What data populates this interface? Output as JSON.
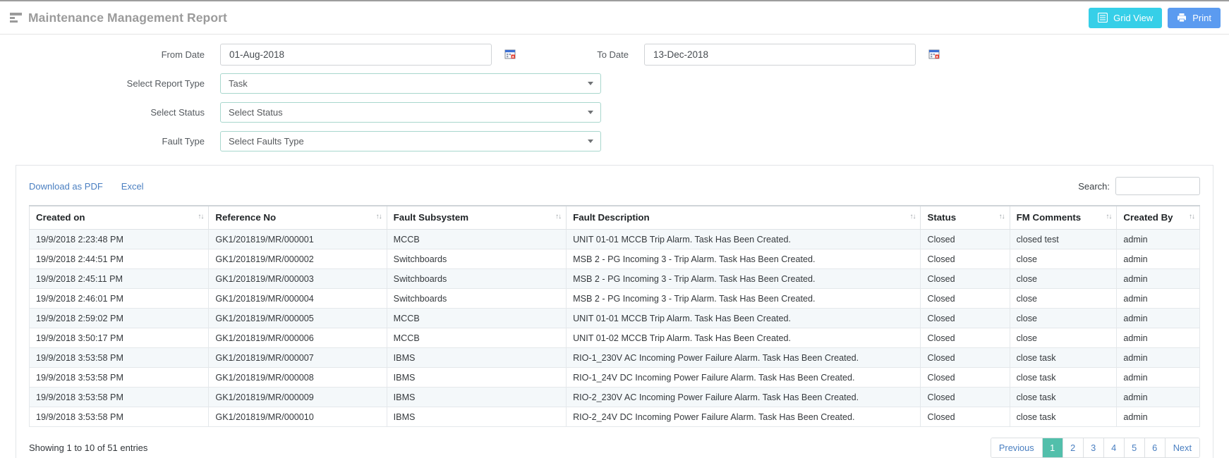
{
  "header": {
    "title": "Maintenance Management Report",
    "icon": "report-lines-icon",
    "buttons": [
      {
        "label": "Grid  View",
        "icon": "grid-icon",
        "color": "#36cfe8",
        "name": "grid-view-button"
      },
      {
        "label": "Print",
        "icon": "printer-icon",
        "color": "#5b9bf0",
        "name": "print-button"
      }
    ]
  },
  "filters": {
    "from_date": {
      "label": "From Date",
      "value": "01-Aug-2018",
      "placeholder": "From Date",
      "calendar_icon": "calendar-icon"
    },
    "to_date": {
      "label": "To Date",
      "value": "13-Dec-2018",
      "placeholder": "To Date",
      "calendar_icon": "calendar-icon"
    },
    "report_type": {
      "label": "Select Report Type",
      "value": "Task"
    },
    "status": {
      "label": "Select Status",
      "value": "Select Status"
    },
    "fault_type": {
      "label": "Fault Type",
      "value": "Select Faults Type"
    }
  },
  "table_tools": {
    "download_pdf": "Download as PDF",
    "excel": "Excel",
    "search_label": "Search:",
    "search_value": "",
    "search_placeholder": ""
  },
  "table": {
    "sort_icon": "↑↓",
    "columns": [
      "Created on",
      "Reference No",
      "Fault Subsystem",
      "Fault Description",
      "Status",
      "FM Comments",
      "Created By"
    ],
    "rows": [
      [
        "19/9/2018 2:23:48 PM",
        "GK1/201819/MR/000001",
        "MCCB",
        "UNIT 01-01 MCCB Trip Alarm. Task Has Been Created.",
        "Closed",
        "closed test",
        "admin"
      ],
      [
        "19/9/2018 2:44:51 PM",
        "GK1/201819/MR/000002",
        "Switchboards",
        "MSB 2 - PG Incoming 3 - Trip Alarm. Task Has Been Created.",
        "Closed",
        "close",
        "admin"
      ],
      [
        "19/9/2018 2:45:11 PM",
        "GK1/201819/MR/000003",
        "Switchboards",
        "MSB 2 - PG Incoming 3 - Trip Alarm. Task Has Been Created.",
        "Closed",
        "close",
        "admin"
      ],
      [
        "19/9/2018 2:46:01 PM",
        "GK1/201819/MR/000004",
        "Switchboards",
        "MSB 2 - PG Incoming 3 - Trip Alarm. Task Has Been Created.",
        "Closed",
        "close",
        "admin"
      ],
      [
        "19/9/2018 2:59:02 PM",
        "GK1/201819/MR/000005",
        "MCCB",
        "UNIT 01-01 MCCB Trip Alarm. Task Has Been Created.",
        "Closed",
        "close",
        "admin"
      ],
      [
        "19/9/2018 3:50:17 PM",
        "GK1/201819/MR/000006",
        "MCCB",
        "UNIT 01-02 MCCB Trip Alarm. Task Has Been Created.",
        "Closed",
        "close",
        "admin"
      ],
      [
        "19/9/2018 3:53:58 PM",
        "GK1/201819/MR/000007",
        "IBMS",
        "RIO-1_230V AC Incoming Power Failure Alarm. Task Has Been Created.",
        "Closed",
        "close task",
        "admin"
      ],
      [
        "19/9/2018 3:53:58 PM",
        "GK1/201819/MR/000008",
        "IBMS",
        "RIO-1_24V DC Incoming Power Failure Alarm. Task Has Been Created.",
        "Closed",
        "close task",
        "admin"
      ],
      [
        "19/9/2018 3:53:58 PM",
        "GK1/201819/MR/000009",
        "IBMS",
        "RIO-2_230V AC Incoming Power Failure Alarm. Task Has Been Created.",
        "Closed",
        "close task",
        "admin"
      ],
      [
        "19/9/2018 3:53:58 PM",
        "GK1/201819/MR/000010",
        "IBMS",
        "RIO-2_24V DC Incoming Power Failure Alarm. Task Has Been Created.",
        "Closed",
        "close task",
        "admin"
      ]
    ]
  },
  "footer": {
    "showing": "Showing 1 to 10 of 51 entries",
    "pagination": {
      "previous": "Previous",
      "next": "Next",
      "pages": [
        "1",
        "2",
        "3",
        "4",
        "5",
        "6"
      ],
      "active": "1",
      "active_color": "#52bfab"
    }
  }
}
